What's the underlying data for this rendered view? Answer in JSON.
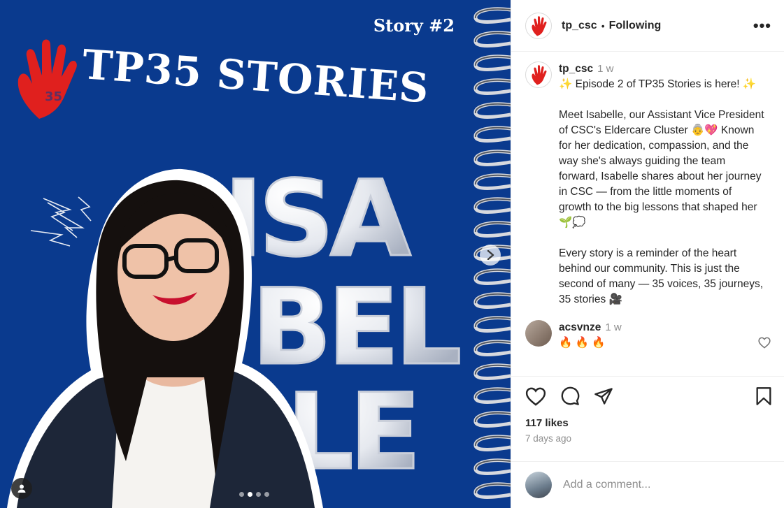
{
  "media": {
    "story_label": "Story #2",
    "title": "TP35 STORIES",
    "bubble_lines": [
      "ISA",
      "BEL",
      "LE"
    ],
    "slide_count": 4,
    "active_slide": 1,
    "colors": {
      "background": "#0a3a8e",
      "logo": "#e0201e"
    }
  },
  "header": {
    "username": "tp_csc",
    "separator": "•",
    "follow_label": "Following",
    "more_label": "•••"
  },
  "caption": {
    "username": "tp_csc",
    "time": "1 w",
    "lines": [
      "✨ Episode 2 of TP35 Stories is here! ✨",
      "",
      "Meet Isabelle, our Assistant Vice President of CSC's Eldercare Cluster 👵💖 Known for her dedication, compassion, and the way she's always guiding the team forward, Isabelle shares about her journey in CSC — from the little moments of growth to the big lessons that shaped her 🌱💭",
      "",
      "Every story is a reminder of the heart behind our community. This is just the second of many — 35 voices, 35 journeys, 35 stories 🎥"
    ]
  },
  "comment": {
    "username": "acsvnze",
    "time": "1 w",
    "text": "🔥 🔥 🔥"
  },
  "actions": {
    "likes": "117 likes",
    "date": "7 days ago"
  },
  "add_comment": {
    "placeholder": "Add a comment..."
  }
}
